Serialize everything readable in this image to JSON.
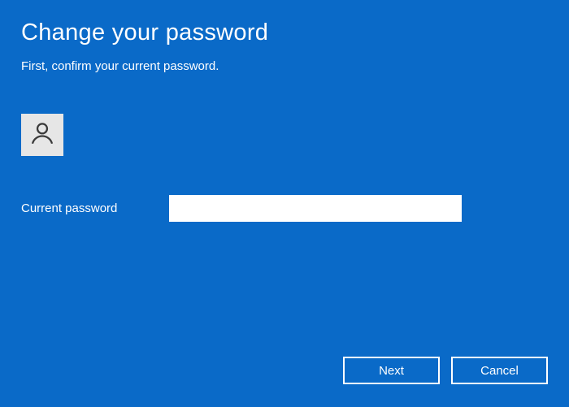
{
  "header": {
    "title": "Change your password",
    "subtitle": "First, confirm your current password."
  },
  "form": {
    "current_password_label": "Current password",
    "current_password_value": ""
  },
  "buttons": {
    "next_label": "Next",
    "cancel_label": "Cancel"
  }
}
